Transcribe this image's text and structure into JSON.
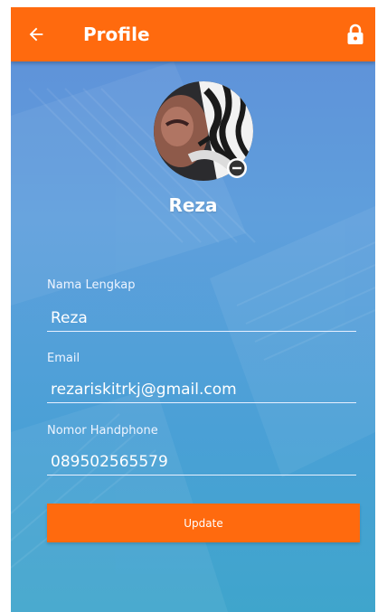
{
  "appbar": {
    "title": "Profile",
    "back_icon": "arrow-left-icon",
    "lock_icon": "lock-icon",
    "color": "#ff6a0e"
  },
  "profile": {
    "name": "Reza",
    "avatar_badge_icon": "minus-circle-icon"
  },
  "form": {
    "full_name": {
      "label": "Nama Lengkap",
      "value": "Reza"
    },
    "email": {
      "label": "Email",
      "value": "rezariskitrkj@gmail.com"
    },
    "phone": {
      "label": "Nomor Handphone",
      "value": "089502565579"
    }
  },
  "update_button": {
    "label": "Update",
    "color": "#ff6a0e"
  }
}
